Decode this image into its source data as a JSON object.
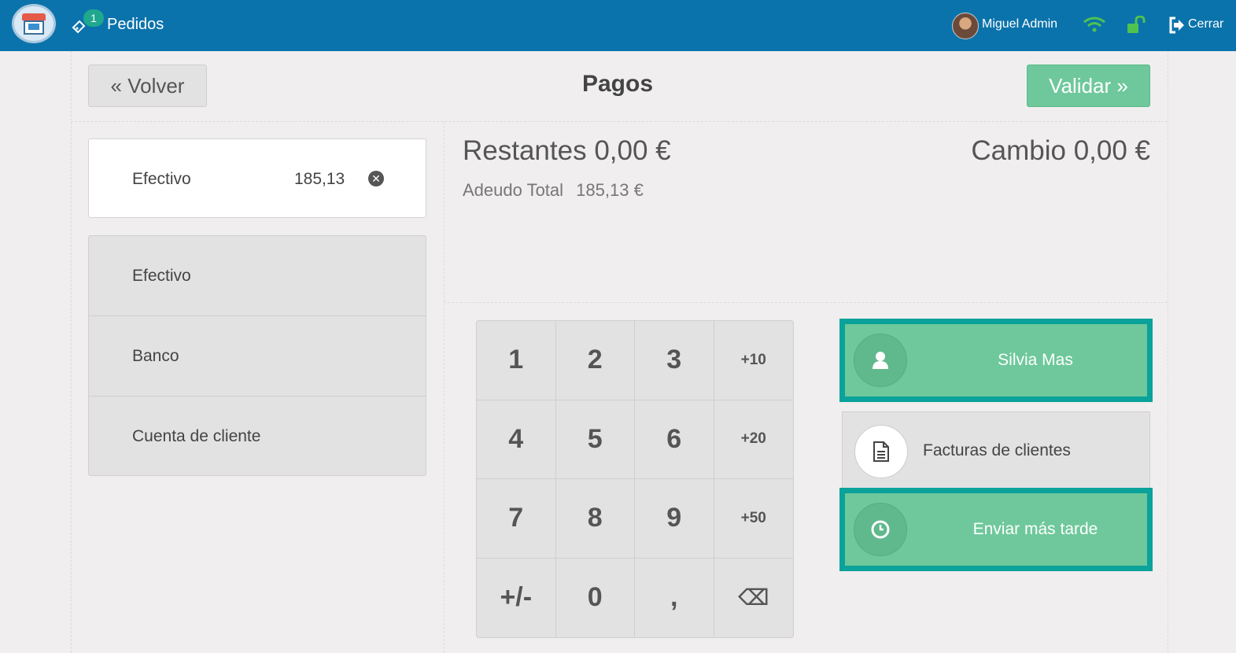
{
  "header": {
    "orders_badge": "1",
    "orders_label": "Pedidos",
    "user_name": "Miguel Admin",
    "close_label": "Cerrar"
  },
  "toolbar": {
    "back_label": "« Volver",
    "title": "Pagos",
    "validate_label": "Validar »"
  },
  "payment_line": {
    "method": "Efectivo",
    "amount": "185,13"
  },
  "payment_methods": [
    "Efectivo",
    "Banco",
    "Cuenta de cliente"
  ],
  "summary": {
    "remaining_label": "Restantes",
    "remaining_value": "0,00 €",
    "change_label": "Cambio",
    "change_value": "0,00 €",
    "due_label": "Adeudo Total",
    "due_value": "185,13 €"
  },
  "numpad": {
    "keys": [
      "1",
      "2",
      "3",
      "+10",
      "4",
      "5",
      "6",
      "+20",
      "7",
      "8",
      "9",
      "+50",
      "+/-",
      "0",
      ",",
      "⌫"
    ]
  },
  "actions": {
    "customer": "Silvia Mas",
    "invoice": "Facturas de clientes",
    "send_later": "Enviar más tarde"
  },
  "colors": {
    "topbar": "#0b73ab",
    "accent_green": "#6ec89b",
    "highlight_teal": "#0aa29a",
    "badge": "#1fa88e"
  }
}
